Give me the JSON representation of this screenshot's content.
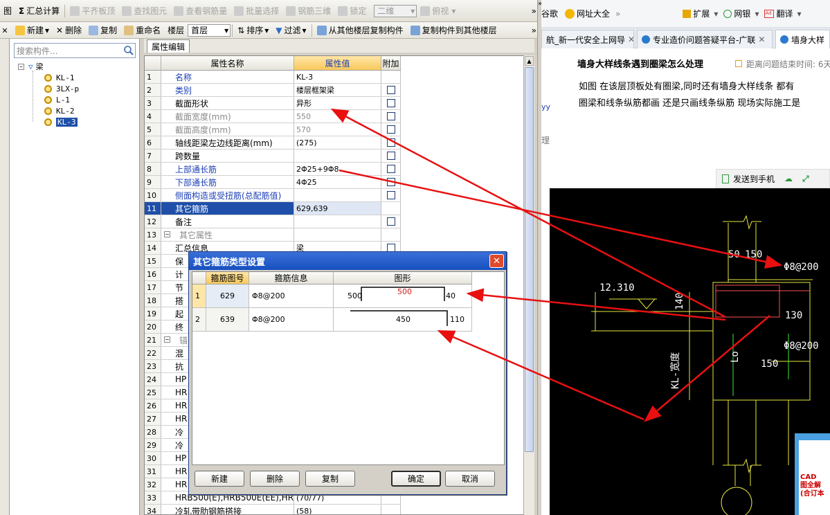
{
  "toolbar1": {
    "items": [
      "图",
      "汇总计算",
      "平齐板顶",
      "查找图元",
      "查看钢筋量",
      "批量选择",
      "钢筋三维",
      "锁定"
    ],
    "view_mode": "二维",
    "view_angle": "俯视"
  },
  "toolbar2": {
    "items": [
      "新建",
      "删除",
      "复制",
      "重命名"
    ],
    "floor_label": "楼层",
    "floor_value": "首层",
    "sort": "排序",
    "filter": "过滤",
    "copy_from": "从其他楼层复制构件",
    "copy_to": "复制构件到其他楼层"
  },
  "tree": {
    "search_placeholder": "搜索构件...",
    "root": "梁",
    "children": [
      "KL-1",
      "3LX-p",
      "L-1",
      "KL-2",
      "KL-3"
    ],
    "selected": "KL-3"
  },
  "props": {
    "tab": "属性编辑",
    "headers": [
      "属性名称",
      "属性值",
      "附加"
    ],
    "rows": [
      {
        "n": "1",
        "name": "名称",
        "value": "KL-3"
      },
      {
        "n": "2",
        "name": "类别",
        "value": "楼层框架梁"
      },
      {
        "n": "3",
        "name": "截面形状",
        "value": "异形"
      },
      {
        "n": "4",
        "name": "截面宽度(mm)",
        "value": "550"
      },
      {
        "n": "5",
        "name": "截面高度(mm)",
        "value": "570"
      },
      {
        "n": "6",
        "name": "轴线距梁左边线距离(mm)",
        "value": "(275)"
      },
      {
        "n": "7",
        "name": "跨数量",
        "value": ""
      },
      {
        "n": "8",
        "name": "上部通长筋",
        "value": "2Φ25+9Φ8"
      },
      {
        "n": "9",
        "name": "下部通长筋",
        "value": "4Φ25"
      },
      {
        "n": "10",
        "name": "侧面构造或受扭筋(总配筋值)",
        "value": ""
      },
      {
        "n": "11",
        "name": "其它箍筋",
        "value": "629,639"
      },
      {
        "n": "12",
        "name": "备注",
        "value": ""
      },
      {
        "n": "13",
        "name": "其它属性",
        "value": ""
      },
      {
        "n": "14",
        "name": "汇总信息",
        "value": "梁"
      },
      {
        "n": "15",
        "name": "保",
        "value": ""
      },
      {
        "n": "16",
        "name": "计",
        "value": ""
      },
      {
        "n": "17",
        "name": "节",
        "value": ""
      },
      {
        "n": "18",
        "name": "搭",
        "value": ""
      },
      {
        "n": "19",
        "name": "起",
        "value": ""
      },
      {
        "n": "20",
        "name": "终",
        "value": ""
      },
      {
        "n": "21",
        "name": "锚固",
        "value": ""
      },
      {
        "n": "22",
        "name": "混",
        "value": ""
      },
      {
        "n": "23",
        "name": "抗",
        "value": ""
      },
      {
        "n": "24",
        "name": "HP",
        "value": ""
      },
      {
        "n": "25",
        "name": "HR",
        "value": ""
      },
      {
        "n": "26",
        "name": "HR",
        "value": ""
      },
      {
        "n": "27",
        "name": "HR",
        "value": ""
      },
      {
        "n": "28",
        "name": "冷",
        "value": ""
      },
      {
        "n": "29",
        "name": "冷",
        "value": ""
      },
      {
        "n": "30",
        "name": "HP",
        "value": ""
      },
      {
        "n": "31",
        "name": "HR",
        "value": ""
      },
      {
        "n": "32",
        "name": "HR",
        "value": ""
      },
      {
        "n": "33",
        "name": "HRB500(E),HRB500E(EE),HRBF",
        "value": "(70/77)"
      },
      {
        "n": "34",
        "name": "冷轧带肋钢筋搭接",
        "value": "(58)"
      }
    ]
  },
  "dialog": {
    "title": "其它箍筋类型设置",
    "close": "✕",
    "headers": [
      "箍筋图号",
      "箍筋信息",
      "图形"
    ],
    "rows": [
      {
        "n": "1",
        "code": "629",
        "info": "Φ8@200",
        "a": "500",
        "b": "500",
        "c": "40"
      },
      {
        "n": "2",
        "code": "639",
        "info": "Φ8@200",
        "a": "450",
        "b": "110"
      }
    ],
    "buttons": {
      "new": "新建",
      "delete": "删除",
      "copy": "复制",
      "ok": "确定",
      "cancel": "取消"
    }
  },
  "browser": {
    "items": [
      "谷歌",
      "网址大全",
      "扩展",
      "网银",
      "翻译"
    ],
    "tabs": [
      "航_新一代安全上网导",
      "专业造价问题答疑平台-广联",
      "墙身大样"
    ],
    "question_title": "墙身大样线条遇到圈梁怎么处理",
    "remaining": "距离问题结束时间: 6天",
    "body_line1": "如图  在该层顶板处有圈梁,同时还有墙身大样线条  都有",
    "body_line2": "圈梁和线条纵筋都画  还是只画线条纵筋  现场实际施工是",
    "side1": "yy",
    "side2": "理",
    "send_phone": "发送到手机"
  },
  "cad": {
    "labels": [
      "50",
      "150",
      "Φ8@200",
      "12.310",
      "140",
      "130",
      "Φ8@200",
      "150",
      "Lo",
      "KL-宽度"
    ]
  },
  "ad": {
    "line1": "CAD",
    "line2": "图全解",
    "line3": "(合订本"
  }
}
